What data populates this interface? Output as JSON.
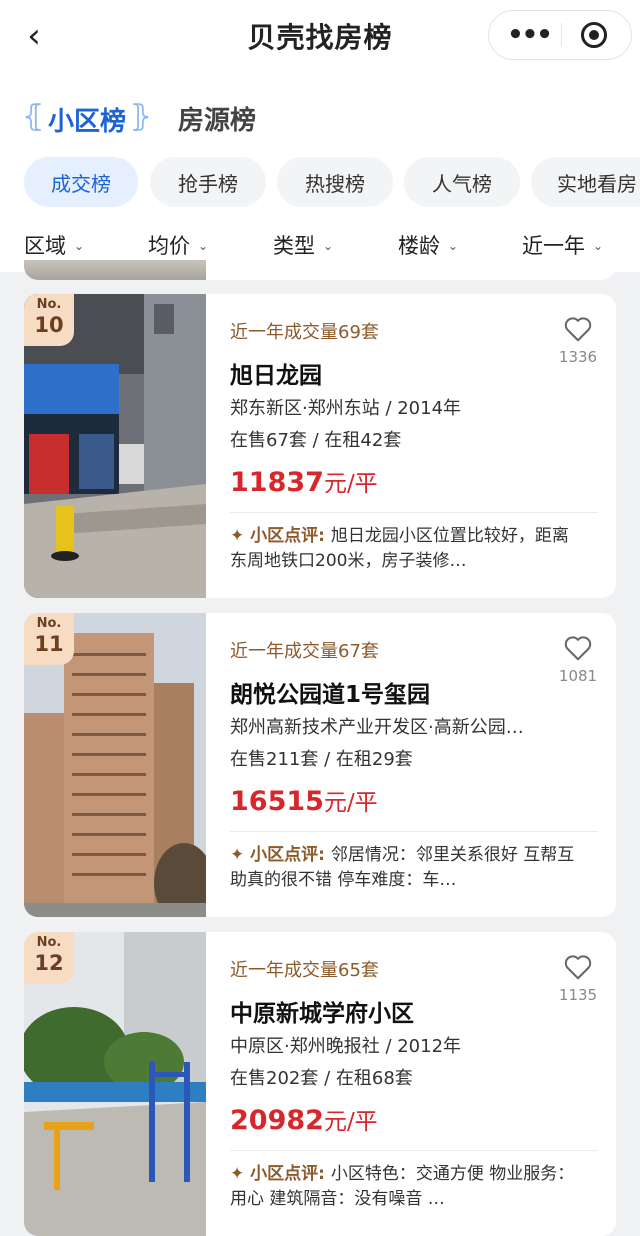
{
  "nav": {
    "title": "贝壳找房榜",
    "more_icon": "more-dots-icon",
    "target_icon": "target-icon"
  },
  "rank_tabs": [
    {
      "label": "小区榜",
      "active": true
    },
    {
      "label": "房源榜",
      "active": false
    }
  ],
  "chips": [
    {
      "label": "成交榜",
      "active": true
    },
    {
      "label": "抢手榜",
      "active": false
    },
    {
      "label": "热搜榜",
      "active": false
    },
    {
      "label": "人气榜",
      "active": false
    },
    {
      "label": "实地看房",
      "active": false
    }
  ],
  "filters": [
    "区域",
    "均价",
    "类型",
    "楼龄",
    "近一年"
  ],
  "colors": {
    "accent": "#1c64d6",
    "price": "#d8262a",
    "deal": "#8c5a2b",
    "badge": "#f6dcc2"
  },
  "listings": [
    {
      "badge_no": "No.",
      "rank": "10",
      "deal": "近一年成交量69套",
      "name": "旭日龙园",
      "location": "郑东新区·郑州东站 / 2014年",
      "stock": "在售67套 / 在租42套",
      "price_num": "11837",
      "price_unit": "元/平",
      "review_label": "✦ 小区点评: ",
      "review_text": "旭日龙园小区位置比较好，距离东周地铁口200米，房子装修…",
      "fav_count": "1336"
    },
    {
      "badge_no": "No.",
      "rank": "11",
      "deal": "近一年成交量67套",
      "name": "朗悦公园道1号玺园",
      "location": "郑州高新技术产业开发区·高新公园…",
      "stock": "在售211套 / 在租29套",
      "price_num": "16515",
      "price_unit": "元/平",
      "review_label": "✦ 小区点评: ",
      "review_text": "邻居情况：邻里关系很好 互帮互助真的很不错 停车难度：车…",
      "fav_count": "1081"
    },
    {
      "badge_no": "No.",
      "rank": "12",
      "deal": "近一年成交量65套",
      "name": "中原新城学府小区",
      "location": "中原区·郑州晚报社 / 2012年",
      "stock": "在售202套 / 在租68套",
      "price_num": "20982",
      "price_unit": "元/平",
      "review_label": "✦ 小区点评: ",
      "review_text": "小区特色：交通方便 物业服务：用心 建筑隔音：没有噪音 …",
      "fav_count": "1135"
    }
  ]
}
